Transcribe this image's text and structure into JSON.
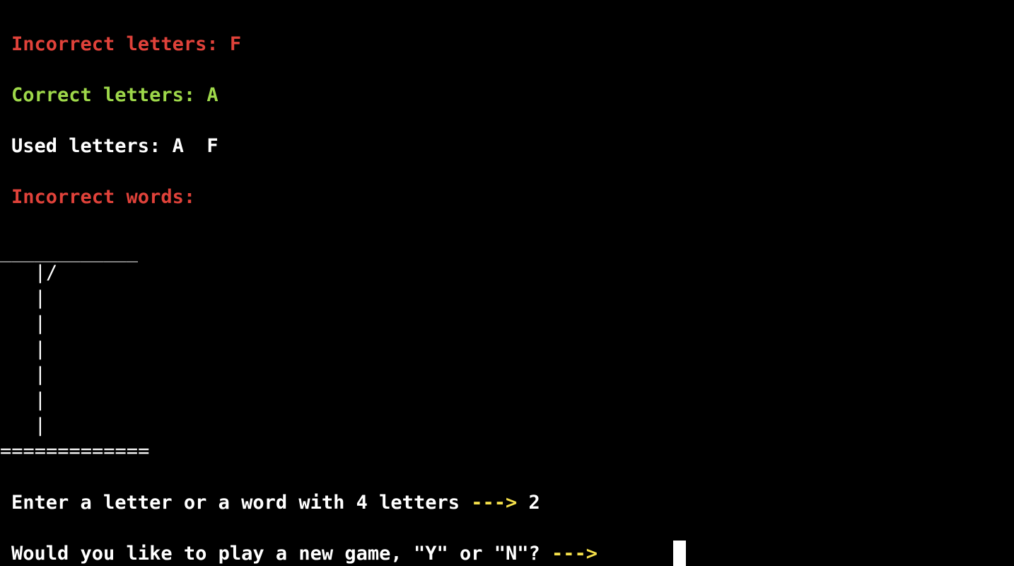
{
  "status": {
    "incorrect_letters": "Incorrect letters: F",
    "correct_letters": "Correct letters: A",
    "used_letters": "Used letters: A  F",
    "incorrect_words": "Incorrect words:"
  },
  "gallows": {
    "top": "____________",
    "rows": [
      "   |/",
      "   |",
      "   |",
      "   |",
      "   |",
      "   |",
      "   |"
    ],
    "base": "============="
  },
  "prompts": {
    "enter_letter": "Enter a letter or a word with 4 letters ",
    "enter_arrow": "--->",
    "enter_answer": " 2",
    "play_again": "Would you like to play a new game, \"Y\" or \"N\"? ",
    "play_again_arrow": "--->"
  },
  "colors": {
    "background": "#000000",
    "incorrect": "#e0423a",
    "correct": "#9ed84a",
    "arrow": "#f5e04a",
    "text": "#ffffff"
  }
}
